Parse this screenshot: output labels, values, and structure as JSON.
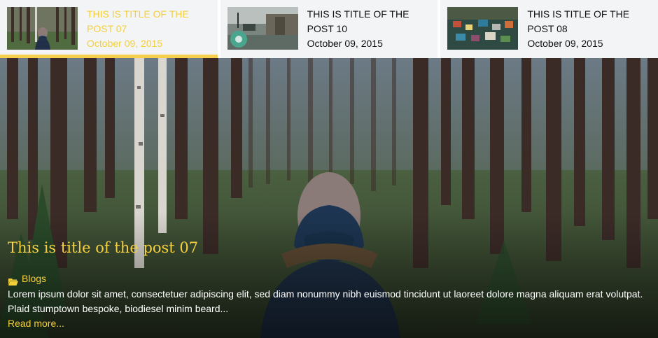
{
  "tabs": [
    {
      "title": "THIS IS TITLE OF THE POST 07",
      "date": "October 09, 2015",
      "active": true
    },
    {
      "title": "THIS IS TITLE OF THE POST 10",
      "date": "October 09, 2015",
      "active": false
    },
    {
      "title": "THIS IS TITLE OF THE POST 08",
      "date": "October 09, 2015",
      "active": false
    }
  ],
  "featured": {
    "title": "This is title of the post 07",
    "category": "Blogs",
    "excerpt": "Lorem ipsum dolor sit amet, consectetuer adipiscing elit, sed diam nonummy nibh euismod tincidunt ut laoreet dolore magna aliquam erat volutpat. Plaid stumptown bespoke, biodiesel minim beard...",
    "read_more": "Read more..."
  },
  "colors": {
    "accent": "#f6d04d",
    "tab_bg": "#f3f4f6"
  },
  "icons": {
    "category": "folder-open-icon"
  }
}
